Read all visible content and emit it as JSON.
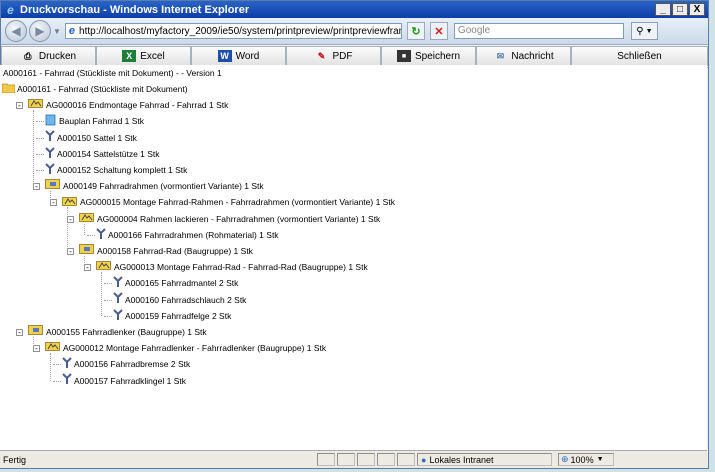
{
  "window": {
    "title": "Druckvorschau - Windows Internet Explorer",
    "minimize": "_",
    "restore": "□",
    "close": "X"
  },
  "address_bar": {
    "url": "http://localhost/myfactory_2009/ie50/system/printpreview/printpreviewframe",
    "search_placeholder": "Google"
  },
  "toolbar": {
    "buttons": [
      {
        "label": "Drucken",
        "icon": "printer-icon"
      },
      {
        "label": "Excel",
        "icon": "excel-icon"
      },
      {
        "label": "Word",
        "icon": "word-icon"
      },
      {
        "label": "PDF",
        "icon": "pdf-icon"
      },
      {
        "label": "Speichern",
        "icon": "save-icon"
      },
      {
        "label": "Nachricht",
        "icon": "message-icon"
      },
      {
        "label": "Schließen",
        "icon": ""
      }
    ]
  },
  "document": {
    "header": "A000161 - Fahrrad (Stückliste mit Dokument) - - Version 1",
    "tree": [
      {
        "label": "A000161 - Fahrrad (Stückliste mit Dokument)",
        "icon": "folder-icon",
        "depth": 0
      },
      {
        "label": "AG000016 Endmontage Fahrrad - Fahrrad 1 Stk",
        "icon": "workstep-icon",
        "depth": 1,
        "expander": "-"
      },
      {
        "label": "Bauplan Fahrrad 1 Stk",
        "icon": "document-icon",
        "depth": 2
      },
      {
        "label": "A000150 Sattel 1 Stk",
        "icon": "part-icon",
        "depth": 2
      },
      {
        "label": "A000154 Sattelstütze 1 Stk",
        "icon": "part-icon",
        "depth": 2
      },
      {
        "label": "A000152 Schaltung komplett 1 Stk",
        "icon": "part-icon",
        "depth": 2
      },
      {
        "label": "A000149 Fahrradrahmen (vormontiert Variante) 1 Stk",
        "icon": "assembly-icon",
        "depth": 2,
        "expander": "-"
      },
      {
        "label": "AG000015 Montage Fahrrad-Rahmen - Fahrradrahmen (vormontiert Variante) 1 Stk",
        "icon": "workstep-icon",
        "depth": 3,
        "expander": "-"
      },
      {
        "label": "AG000004 Rahmen lackieren - Fahrradrahmen (vormontiert Variante) 1 Stk",
        "icon": "workstep-icon",
        "depth": 4,
        "expander": "-"
      },
      {
        "label": "A000166 Fahrradrahmen (Rohmaterial) 1 Stk",
        "icon": "part-icon",
        "depth": 5
      },
      {
        "label": "A000158 Fahrrad-Rad (Baugruppe) 1 Stk",
        "icon": "assembly-icon",
        "depth": 4,
        "expander": "-"
      },
      {
        "label": "AG000013 Montage Fahrrad-Rad - Fahrrad-Rad (Baugruppe) 1 Stk",
        "icon": "workstep-icon",
        "depth": 5,
        "expander": "-"
      },
      {
        "label": "A000165 Fahrradmantel 2 Stk",
        "icon": "part-icon",
        "depth": 6
      },
      {
        "label": "A000160 Fahrradschlauch 2 Stk",
        "icon": "part-icon",
        "depth": 6
      },
      {
        "label": "A000159 Fahrradfelge 2 Stk",
        "icon": "part-icon",
        "depth": 6
      },
      {
        "label": "A000155 Fahrradlenker (Baugruppe) 1 Stk",
        "icon": "assembly-icon",
        "depth": 1,
        "expander": "-"
      },
      {
        "label": "AG000012 Montage Fahrradlenker - Fahrradlenker (Baugruppe) 1 Stk",
        "icon": "workstep-icon",
        "depth": 2,
        "expander": "-"
      },
      {
        "label": "A000156 Fahrradbremse 2 Stk",
        "icon": "part-icon",
        "depth": 3
      },
      {
        "label": "A000157 Fahrradklingel 1 Stk",
        "icon": "part-icon",
        "depth": 3
      }
    ]
  },
  "status_bar": {
    "left": "Fertig",
    "zone": "Lokales Intranet",
    "zoom": "100%"
  }
}
